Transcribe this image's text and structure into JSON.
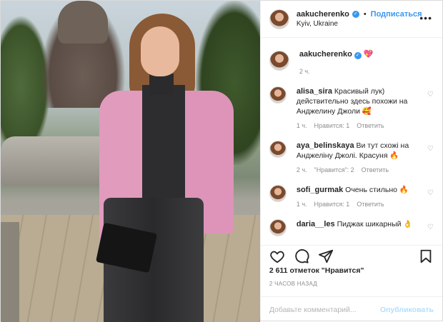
{
  "post": {
    "username": "aakucherenko",
    "location": "Kyiv, Ukraine",
    "follow_label": "Подписаться",
    "more_icon": "ellipsis-icon"
  },
  "caption": {
    "username": "aakucherenko",
    "emoji": "💖",
    "time": "2 ч."
  },
  "comments": [
    {
      "username": "alisa_sira",
      "text": "Красивый лук) действительно здесь похожи на Анджелину Джоли 🥰",
      "time": "1 ч.",
      "likes": "Нравится: 1",
      "reply": "Ответить"
    },
    {
      "username": "aya_belinskaya",
      "text": "Ви тут схожі на Анджеліну Джолі. Красуня 🔥",
      "time": "2 ч.",
      "likes": "\"Нравится\": 2",
      "reply": "Ответить"
    },
    {
      "username": "sofi_gurmak",
      "text": "Очень стильно 🔥",
      "time": "1 ч.",
      "likes": "Нравится: 1",
      "reply": "Ответить"
    },
    {
      "username": "daria__les",
      "text": "Пиджак шикарный 👌",
      "time": "",
      "likes": "",
      "reply": ""
    }
  ],
  "actions": {
    "like": "heart-icon",
    "comment": "comment-icon",
    "share": "send-icon",
    "save": "bookmark-icon"
  },
  "likes_text": "2 611 отметок \"Нравится\"",
  "timestamp": "2 ЧАСОВ НАЗАД",
  "add_comment": {
    "placeholder": "Добавьте комментарий...",
    "publish_label": "Опубликовать"
  },
  "colors": {
    "accent": "#3897f0",
    "publish_disabled": "#b2dffc",
    "muted": "#8e8e8e"
  }
}
